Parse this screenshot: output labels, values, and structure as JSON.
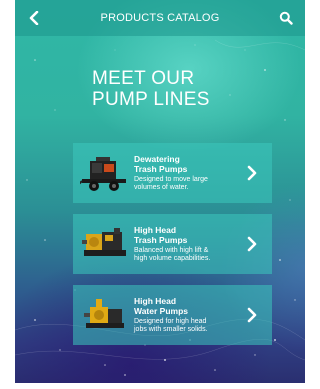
{
  "header": {
    "title": "PRODUCTS CATALOG",
    "back_icon": "chevron-left-icon",
    "search_icon": "search-icon"
  },
  "headline": {
    "line1": "MEET OUR",
    "line2": "PUMP LINES"
  },
  "products": [
    {
      "title_line1": "Dewatering",
      "title_line2": "Trash Pumps",
      "desc_line1": "Designed to move large",
      "desc_line2": "volumes of water."
    },
    {
      "title_line1": "High Head",
      "title_line2": "Trash Pumps",
      "desc_line1": "Balanced with high lift &",
      "desc_line2": "high volume capabilities."
    },
    {
      "title_line1": "High Head",
      "title_line2": "Water Pumps",
      "desc_line1": "Designed for high head",
      "desc_line2": "jobs with smaller solids."
    }
  ],
  "colors": {
    "background_top": "#2fb7a6",
    "background_bottom": "#2a2f70",
    "card": "#3cc8be",
    "text": "#ffffff"
  }
}
